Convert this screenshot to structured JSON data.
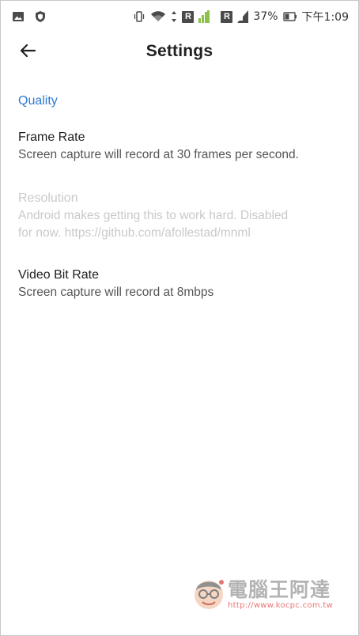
{
  "status_bar": {
    "battery_percent": "37%",
    "time": "下午1:09",
    "r_badge_1": "R",
    "r_badge_2": "R",
    "colors": {
      "signal_active": "#8bc34a",
      "icons": "#444444"
    }
  },
  "app_bar": {
    "title": "Settings"
  },
  "settings": {
    "section_header": "Quality",
    "accent_color": "#2f7bd1",
    "items": [
      {
        "title": "Frame Rate",
        "summary": "Screen capture will record at 30 frames per second.",
        "enabled": true
      },
      {
        "title": "Resolution",
        "summary_line1": "Android makes getting this to work hard. Disabled",
        "summary_line2": "for now. https://github.com/afollestad/mnml",
        "enabled": false
      },
      {
        "title": "Video Bit Rate",
        "summary": "Screen capture will record at 8mbps",
        "enabled": true
      }
    ]
  },
  "watermark": {
    "name": "電腦王阿達",
    "url": "http://www.kocpc.com.tw"
  }
}
